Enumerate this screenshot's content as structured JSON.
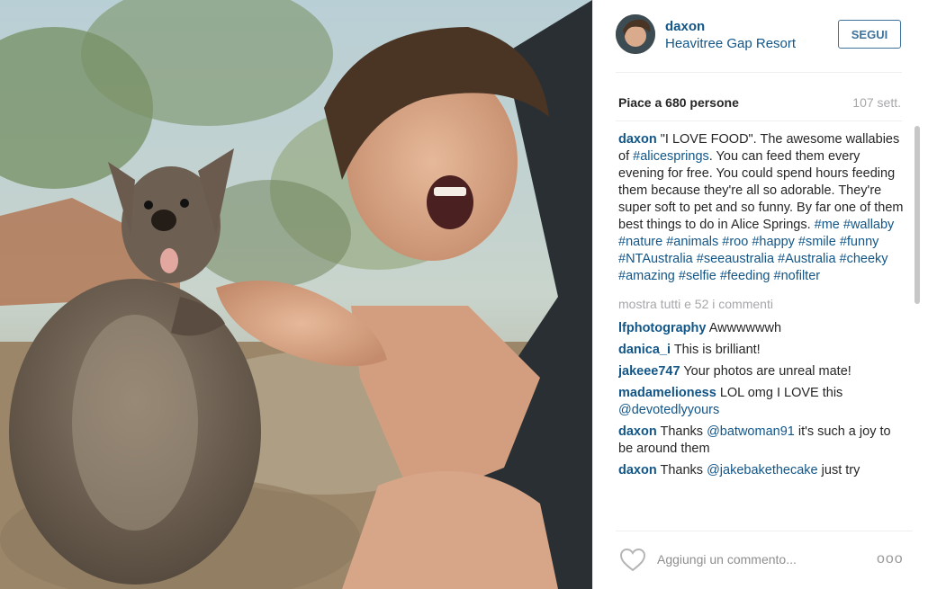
{
  "post": {
    "username": "daxon",
    "location": "Heavitree Gap Resort",
    "follow_label": "SEGUI",
    "likes_text": "Piace a 680 persone",
    "time_ago": "107 sett."
  },
  "caption": {
    "user": "daxon",
    "text_parts": [
      "\"I LOVE FOOD\". The awesome wallabies of ",
      "#alicesprings",
      ". You can feed them every evening for free. You could spend hours feeding them because they're all so adorable. They're super soft to pet and so funny. By far one of them best things to do in Alice Springs. ",
      "#me #wallaby #nature #animals #roo #happy #smile #funny #NTAustralia #seeaustralia #Australia #cheeky #amazing #selfie #feeding #nofilter"
    ]
  },
  "show_all_comments": "mostra tutti e 52 i commenti",
  "comments": [
    {
      "user": "lfphotography",
      "text": "Awwwwwwh"
    },
    {
      "user": "danica_i",
      "text": "This is brilliant!"
    },
    {
      "user": "jakeee747",
      "text": "Your photos are unreal mate!"
    },
    {
      "user": "madamelioness",
      "text": "LOL omg I LOVE this ",
      "mention": "@devotedlyyours",
      "after": ""
    },
    {
      "user": "daxon",
      "text": "Thanks ",
      "mention": "@batwoman91",
      "after": " it's such a joy to be around them"
    },
    {
      "user": "daxon",
      "text": "Thanks ",
      "mention": "@jakebakethecake",
      "after": " just try"
    }
  ],
  "footer": {
    "comment_placeholder": "Aggiungi un commento...",
    "more_label": "ooo"
  },
  "icons": {
    "like": "heart-icon",
    "more": "more-options-icon"
  },
  "colors": {
    "link": "#125688",
    "follow_border": "#3f729b",
    "muted": "#a5a7aa"
  }
}
